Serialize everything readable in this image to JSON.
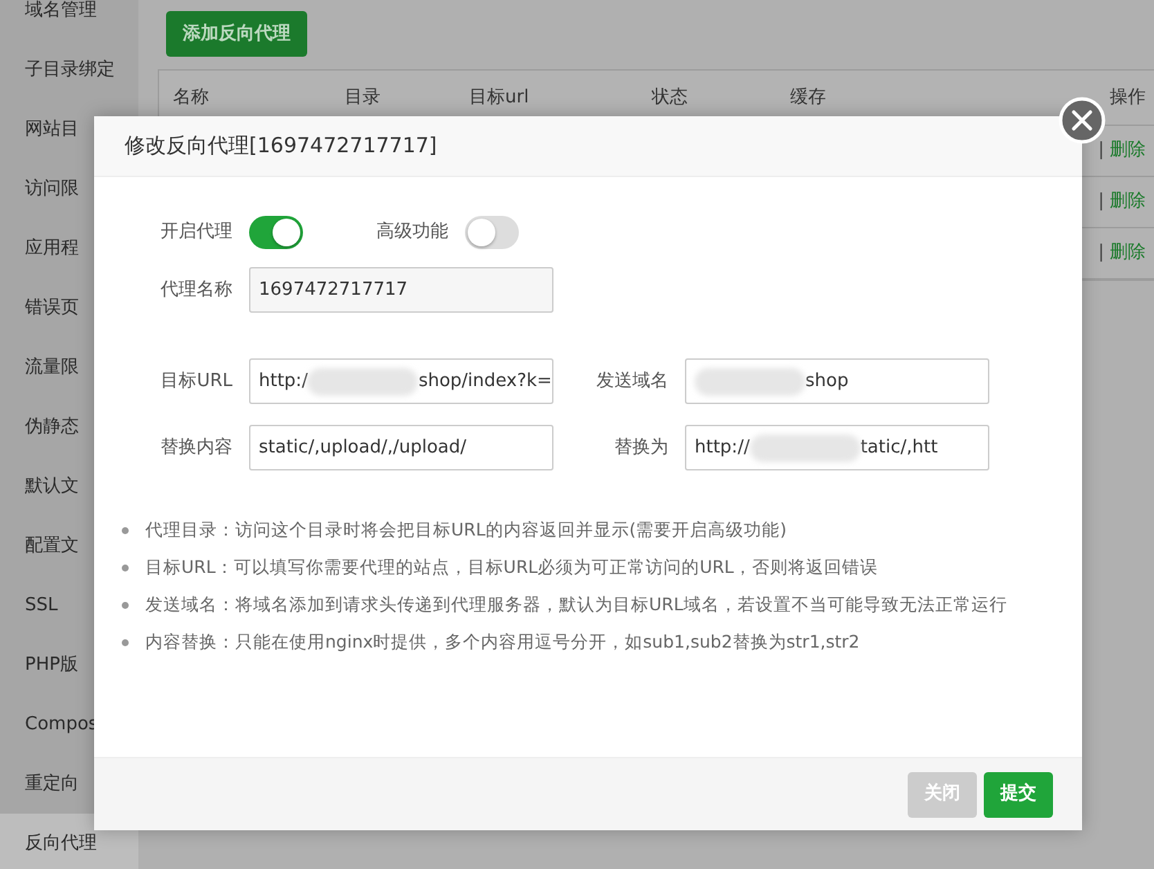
{
  "sidebar": {
    "items": [
      {
        "label": "域名管理",
        "selected": false
      },
      {
        "label": "子目录绑定",
        "selected": false
      },
      {
        "label": "网站目",
        "selected": false
      },
      {
        "label": "访问限",
        "selected": false
      },
      {
        "label": "应用程",
        "selected": false
      },
      {
        "label": "错误页",
        "selected": false
      },
      {
        "label": "流量限",
        "selected": false
      },
      {
        "label": "伪静态",
        "selected": false
      },
      {
        "label": "默认文",
        "selected": false
      },
      {
        "label": "配置文",
        "selected": false
      },
      {
        "label": "SSL",
        "selected": false
      },
      {
        "label": "PHP版",
        "selected": false
      },
      {
        "label": "Compos",
        "selected": false
      },
      {
        "label": "重定向",
        "selected": false
      },
      {
        "label": "反向代理",
        "selected": true
      }
    ]
  },
  "add_button": "添加反向代理",
  "table": {
    "columns": [
      "名称",
      "目录",
      "目标url",
      "状态",
      "缓存",
      "操作"
    ],
    "rows": [
      {
        "separator": "|",
        "delete": "删除"
      },
      {
        "separator": "|",
        "delete": "删除"
      },
      {
        "separator": "|",
        "delete": "删除"
      }
    ]
  },
  "dialog": {
    "title": "修改反向代理[1697472717717]",
    "toggles": [
      {
        "label": "开启代理",
        "on": true
      },
      {
        "label": "高级功能",
        "on": false
      }
    ],
    "name_field": {
      "label": "代理名称",
      "value": "1697472717717"
    },
    "field_rows": [
      [
        {
          "label": "目标URL",
          "parts": [
            {
              "text": "http:/"
            },
            {
              "kind": "redacted"
            },
            {
              "text": "shop/index?k="
            }
          ]
        },
        {
          "label": "发送域名",
          "parts": [
            {
              "kind": "redacted"
            },
            {
              "text": "shop"
            }
          ]
        }
      ],
      [
        {
          "label": "替换内容",
          "parts": [
            {
              "text": "static/,upload/,/upload/"
            }
          ]
        },
        {
          "label": "替换为",
          "parts": [
            {
              "text": "http://"
            },
            {
              "kind": "redacted"
            },
            {
              "text": "tatic/,htt"
            }
          ]
        }
      ]
    ],
    "notes": [
      "代理目录：访问这个目录时将会把目标URL的内容返回并显示(需要开启高级功能)",
      "目标URL：可以填写你需要代理的站点，目标URL必须为可正常访问的URL，否则将返回错误",
      "发送域名：将域名添加到请求头传递到代理服务器，默认为目标URL域名，若设置不当可能导致无法正常运行",
      "内容替换：只能在使用nginx时提供，多个内容用逗号分开，如sub1,sub2替换为str1,str2"
    ],
    "buttons": [
      {
        "label": "关闭",
        "kind": "secondary"
      },
      {
        "label": "提交",
        "kind": "primary"
      }
    ]
  }
}
